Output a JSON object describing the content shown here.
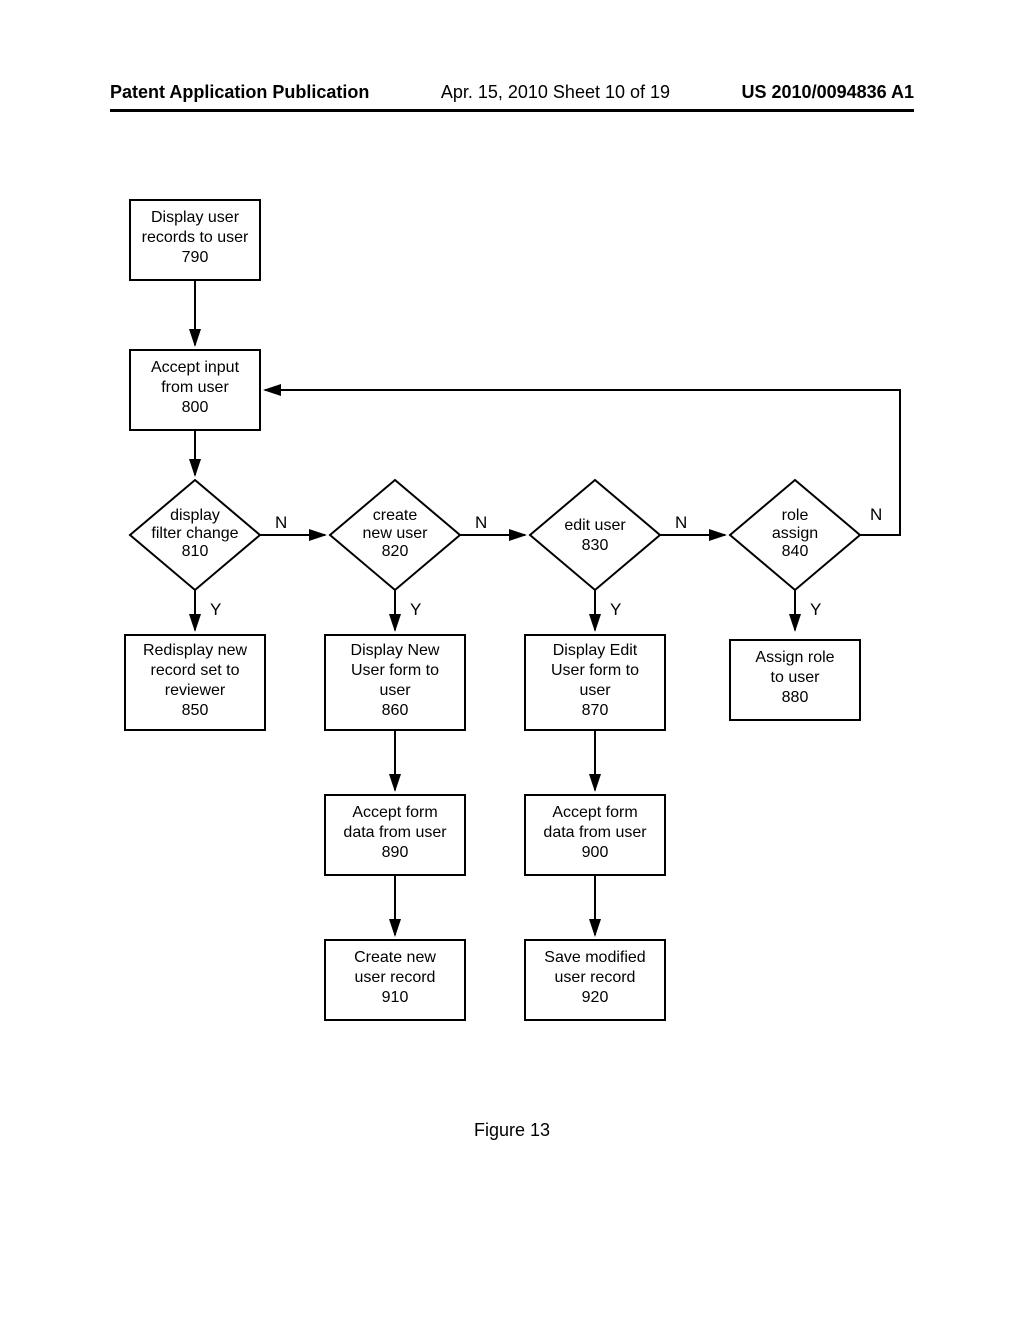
{
  "header": {
    "left": "Patent Application Publication",
    "mid": "Apr. 15, 2010  Sheet 10 of 19",
    "right": "US 2010/0094836 A1"
  },
  "figure_caption": "Figure 13",
  "labels": {
    "yes": "Y",
    "no": "N"
  },
  "nodes": {
    "n790": {
      "l1": "Display user",
      "l2": "records to user",
      "l3": "790"
    },
    "n800": {
      "l1": "Accept input",
      "l2": "from user",
      "l3": "800"
    },
    "d810": {
      "l1": "display",
      "l2": "filter change",
      "l3": "810"
    },
    "d820": {
      "l1": "create",
      "l2": "new user",
      "l3": "820"
    },
    "d830": {
      "l1": "edit user",
      "l2": "830"
    },
    "d840": {
      "l1": "role",
      "l2": "assign",
      "l3": "840"
    },
    "n850": {
      "l1": "Redisplay new",
      "l2": "record set to",
      "l3": "reviewer",
      "l4": "850"
    },
    "n860": {
      "l1": "Display New",
      "l2": "User form to",
      "l3": "user",
      "l4": "860"
    },
    "n870": {
      "l1": "Display Edit",
      "l2": "User form to",
      "l3": "user",
      "l4": "870"
    },
    "n880": {
      "l1": "Assign role",
      "l2": "to user",
      "l3": "880"
    },
    "n890": {
      "l1": "Accept form",
      "l2": "data from user",
      "l3": "890"
    },
    "n900": {
      "l1": "Accept form",
      "l2": "data from user",
      "l3": "900"
    },
    "n910": {
      "l1": "Create new",
      "l2": "user record",
      "l3": "910"
    },
    "n920": {
      "l1": "Save modified",
      "l2": "user record",
      "l3": "920"
    }
  }
}
